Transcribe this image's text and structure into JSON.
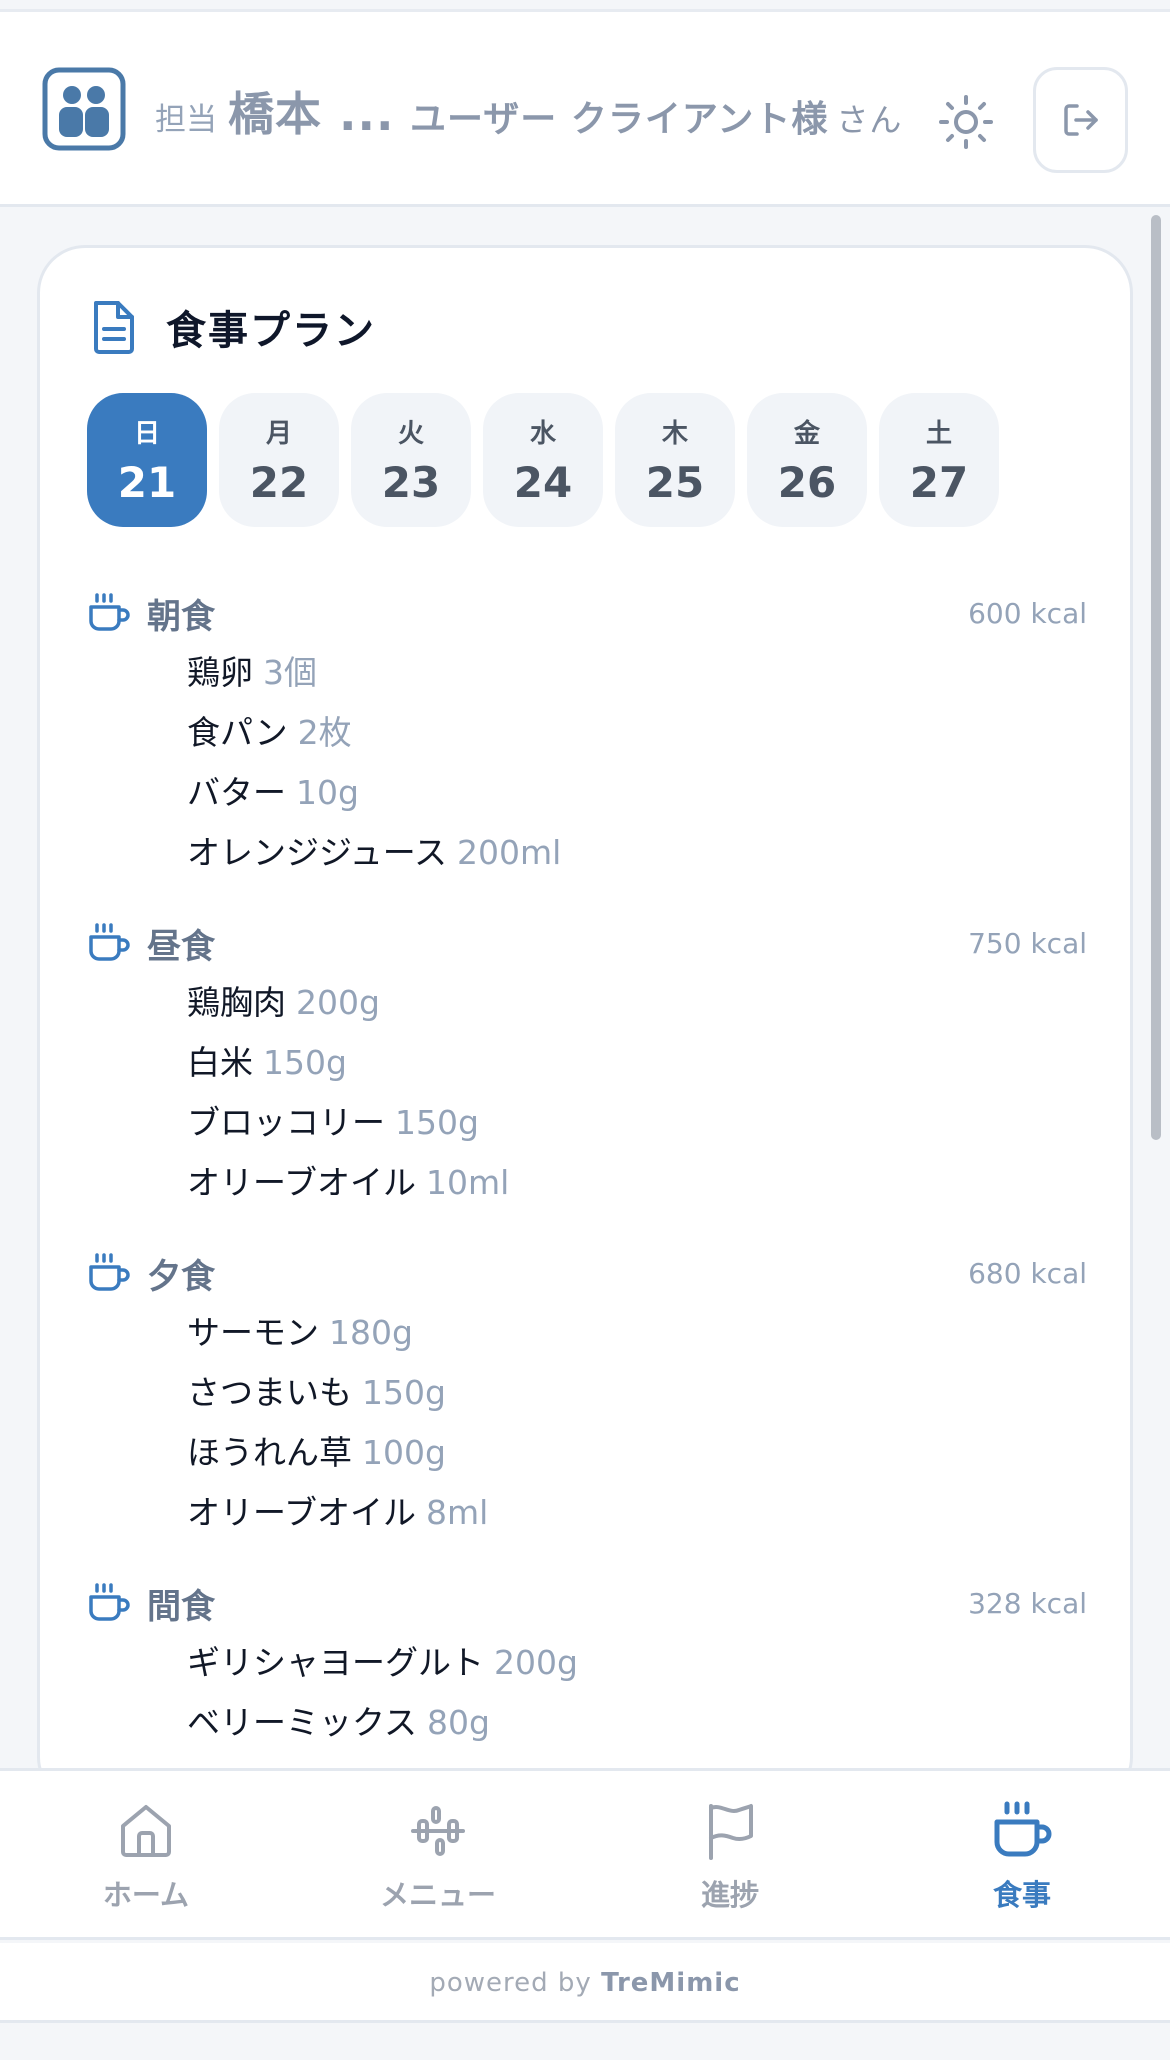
{
  "header": {
    "coach_prefix": "担当",
    "coach_name": "橋本 ...",
    "user_label": "ユーザー クライアント様",
    "user_suffix": "さん"
  },
  "plan": {
    "title": "食事プラン",
    "days": [
      {
        "dow": "日",
        "num": "21",
        "active": true
      },
      {
        "dow": "月",
        "num": "22"
      },
      {
        "dow": "火",
        "num": "23"
      },
      {
        "dow": "水",
        "num": "24"
      },
      {
        "dow": "木",
        "num": "25"
      },
      {
        "dow": "金",
        "num": "26"
      },
      {
        "dow": "土",
        "num": "27"
      }
    ],
    "meals": [
      {
        "name": "朝食",
        "kcal": "600 kcal",
        "items": [
          {
            "food": "鶏卵",
            "amount": "3個"
          },
          {
            "food": "食パン",
            "amount": "2枚"
          },
          {
            "food": "バター",
            "amount": "10g"
          },
          {
            "food": "オレンジジュース",
            "amount": "200ml"
          }
        ]
      },
      {
        "name": "昼食",
        "kcal": "750 kcal",
        "items": [
          {
            "food": "鶏胸肉",
            "amount": "200g"
          },
          {
            "food": "白米",
            "amount": "150g"
          },
          {
            "food": "ブロッコリー",
            "amount": "150g"
          },
          {
            "food": "オリーブオイル",
            "amount": "10ml"
          }
        ]
      },
      {
        "name": "夕食",
        "kcal": "680 kcal",
        "items": [
          {
            "food": "サーモン",
            "amount": "180g"
          },
          {
            "food": "さつまいも",
            "amount": "150g"
          },
          {
            "food": "ほうれん草",
            "amount": "100g"
          },
          {
            "food": "オリーブオイル",
            "amount": "8ml"
          }
        ]
      },
      {
        "name": "間食",
        "kcal": "328 kcal",
        "items": [
          {
            "food": "ギリシャヨーグルト",
            "amount": "200g"
          },
          {
            "food": "ベリーミックス",
            "amount": "80g"
          }
        ]
      }
    ]
  },
  "nav": {
    "items": [
      {
        "label": "ホーム",
        "icon": "home-icon"
      },
      {
        "label": "メニュー",
        "icon": "dumbbell-icon"
      },
      {
        "label": "進捗",
        "icon": "flag-icon"
      },
      {
        "label": "食事",
        "icon": "cup-icon",
        "active": true
      }
    ]
  },
  "footer": {
    "prefix": "powered by",
    "brand": "TreMimic"
  },
  "colors": {
    "accent": "#3a7bbf",
    "muted": "#94a3b8"
  }
}
